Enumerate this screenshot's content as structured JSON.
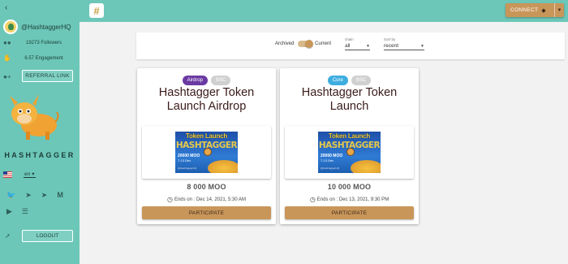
{
  "sidebar": {
    "collapse_icon": "chevron-left-icon",
    "handle": "@HashtaggerHQ",
    "followers": "19273 Followers",
    "engagement": "6.57 Engagement",
    "referral_label": "REFERRAL LINK",
    "brand": "HASHTAGGER",
    "language": "en",
    "socials": [
      "twitter-icon",
      "telegram-icon",
      "telegram-icon",
      "medium-icon",
      "youtube-icon",
      "stack-icon"
    ],
    "logout_label": "LOGOUT"
  },
  "topbar": {
    "hash_symbol": "#",
    "connect_label": "CONNECT",
    "connect_icon": "bnb-icon"
  },
  "filters": {
    "archived_label": "Archived",
    "current_label": "Current",
    "toggle_state": "current",
    "chain_caption": "chain",
    "chain_value": "all",
    "sort_caption": "Sort by",
    "sort_value": "recent"
  },
  "campaigns": [
    {
      "tags": [
        "Airdrop",
        "BSC"
      ],
      "title": "Hashtagger Token Launch Airdrop",
      "banner": {
        "title": "Token Launch",
        "logo": "HASHTAGGER",
        "amount": "20000 MOO",
        "dates": "7-13 Dec",
        "handle": "@HashtaggerHQ"
      },
      "reward": "8 000 MOO",
      "ends": "Ends on : Dec 14, 2021, 5:30 AM",
      "action": "PARTICIPATE"
    },
    {
      "tags": [
        "Core",
        "BSC"
      ],
      "title": "Hashtagger Token Launch",
      "banner": {
        "title": "Token Launch",
        "logo": "HASHTAGGER",
        "amount": "20000 MOO",
        "dates": "7-13 Dec",
        "handle": "@HashtaggerHQ"
      },
      "reward": "10 000 MOO",
      "ends": "Ends on : Dec 13, 2021, 9:30 PM",
      "action": "PARTICIPATE"
    }
  ],
  "colors": {
    "sidebar_bg": "#6cc7b8",
    "accent": "#c9965a",
    "airdrop_chip": "#6a3aa2",
    "core_chip": "#3eaee0",
    "bsc_chip": "#d0d0d0"
  }
}
